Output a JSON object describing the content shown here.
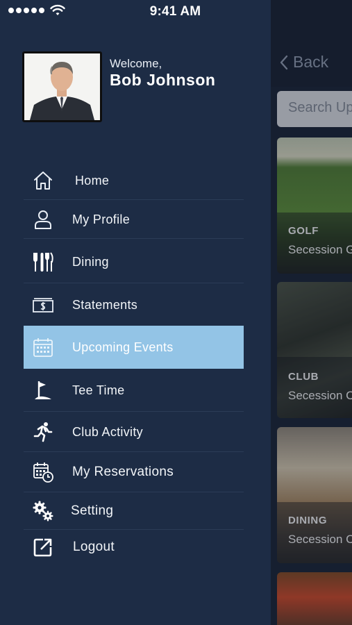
{
  "status_bar": {
    "time": "9:41 AM",
    "signal_bars": 5
  },
  "drawer": {
    "welcome_text": "Welcome,",
    "user_name": "Bob Johnson",
    "menu": [
      {
        "label": "Home",
        "icon": "home-icon",
        "active": false
      },
      {
        "label": "My Profile",
        "icon": "user-icon",
        "active": false
      },
      {
        "label": "Dining",
        "icon": "dining-icon",
        "active": false
      },
      {
        "label": "Statements",
        "icon": "statement-icon",
        "active": false
      },
      {
        "label": "Upcoming Events",
        "icon": "calendar-icon",
        "active": true
      },
      {
        "label": "Tee Time",
        "icon": "golf-flag-icon",
        "active": false
      },
      {
        "label": "Club Activity",
        "icon": "running-icon",
        "active": false
      },
      {
        "label": "My Reservations",
        "icon": "reservation-calendar-icon",
        "active": false
      },
      {
        "label": "Setting",
        "icon": "gears-icon",
        "active": false
      },
      {
        "label": "Logout",
        "icon": "logout-icon",
        "active": false
      }
    ]
  },
  "main": {
    "back_label": "Back",
    "search_placeholder": "Search Up",
    "cards": [
      {
        "category": "GOLF",
        "title": "Secession G"
      },
      {
        "category": "CLUB",
        "title": "Secession C"
      },
      {
        "category": "DINING",
        "title": "Secession C"
      }
    ]
  },
  "colors": {
    "drawer_bg": "#1d2c45",
    "active_item": "#93c4e6",
    "text": "#ffffff"
  }
}
